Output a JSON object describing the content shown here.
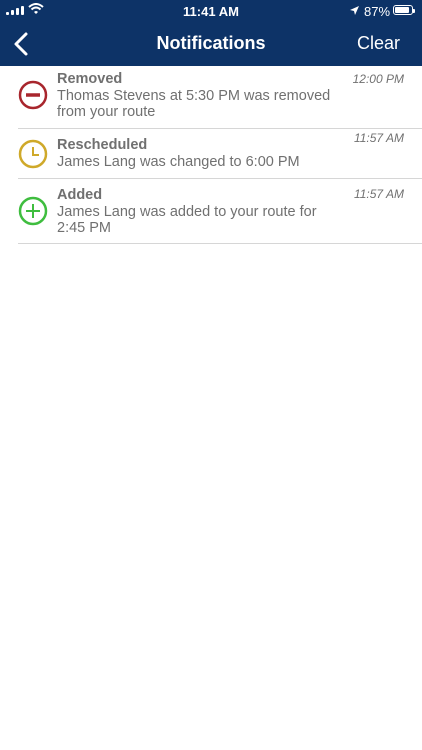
{
  "status_bar": {
    "time": "11:41 AM",
    "battery": "87%",
    "battery_level": 0.87,
    "signal_icon": "cellular-signal-icon",
    "wifi_icon": "wifi-icon",
    "location_icon": "location-arrow-icon"
  },
  "nav": {
    "title": "Notifications",
    "clear_label": "Clear",
    "back_icon": "chevron-left-icon"
  },
  "colors": {
    "header_bg": "#0d3367",
    "removed": "#a8262d",
    "rescheduled": "#cfa92a",
    "added": "#3fbd3f",
    "text": "#707070"
  },
  "notifications": [
    {
      "type": "removed",
      "icon": "minus-circle-icon",
      "title": "Removed",
      "message": "Thomas Stevens at 5:30 PM was removed from your route",
      "time": "12:00 PM"
    },
    {
      "type": "rescheduled",
      "icon": "clock-icon",
      "title": "Rescheduled",
      "message": "James Lang was changed to 6:00 PM",
      "time": "11:57 AM"
    },
    {
      "type": "added",
      "icon": "plus-circle-icon",
      "title": "Added",
      "message": "James Lang was added to your route for 2:45 PM",
      "time": "11:57 AM"
    }
  ]
}
